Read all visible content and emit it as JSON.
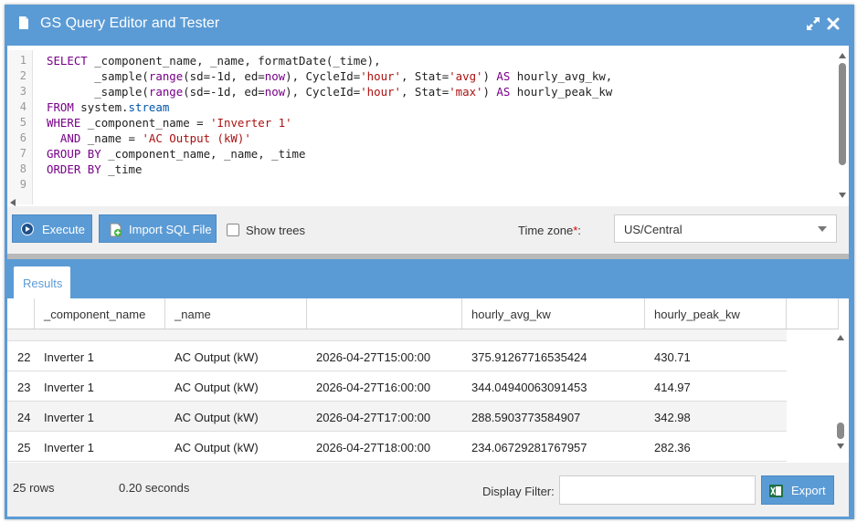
{
  "window": {
    "title": "GS Query Editor and Tester",
    "icons": [
      "document-icon",
      "expand-icon",
      "close-icon"
    ]
  },
  "editor": {
    "line_numbers": [
      "1",
      "2",
      "3",
      "4",
      "5",
      "6",
      "7",
      "8",
      "9"
    ],
    "lines": [
      [
        {
          "t": "SELECT",
          "c": "kw"
        },
        {
          "t": " _component_name, _name, formatDate(_time),",
          "c": ""
        }
      ],
      [
        {
          "t": "       _sample(",
          "c": ""
        },
        {
          "t": "range",
          "c": "kw"
        },
        {
          "t": "(sd=-1d, ed=",
          "c": ""
        },
        {
          "t": "now",
          "c": "kw"
        },
        {
          "t": "), CycleId=",
          "c": ""
        },
        {
          "t": "'hour'",
          "c": "str"
        },
        {
          "t": ", Stat=",
          "c": ""
        },
        {
          "t": "'avg'",
          "c": "str"
        },
        {
          "t": ") ",
          "c": ""
        },
        {
          "t": "AS",
          "c": "kw"
        },
        {
          "t": " hourly_avg_kw,",
          "c": ""
        }
      ],
      [
        {
          "t": "       _sample(",
          "c": ""
        },
        {
          "t": "range",
          "c": "kw"
        },
        {
          "t": "(sd=-1d, ed=",
          "c": ""
        },
        {
          "t": "now",
          "c": "kw"
        },
        {
          "t": "), CycleId=",
          "c": ""
        },
        {
          "t": "'hour'",
          "c": "str"
        },
        {
          "t": ", Stat=",
          "c": ""
        },
        {
          "t": "'max'",
          "c": "str"
        },
        {
          "t": ") ",
          "c": ""
        },
        {
          "t": "AS",
          "c": "kw"
        },
        {
          "t": " hourly_peak_kw",
          "c": ""
        }
      ],
      [
        {
          "t": "FROM",
          "c": "kw"
        },
        {
          "t": " system.",
          "c": ""
        },
        {
          "t": "stream",
          "c": "fn"
        }
      ],
      [
        {
          "t": "WHERE",
          "c": "kw"
        },
        {
          "t": " _component_name = ",
          "c": ""
        },
        {
          "t": "'Inverter 1'",
          "c": "str"
        }
      ],
      [
        {
          "t": "  AND",
          "c": "kw"
        },
        {
          "t": " _name = ",
          "c": ""
        },
        {
          "t": "'AC Output (kW)'",
          "c": "str"
        }
      ],
      [
        {
          "t": "GROUP BY",
          "c": "kw"
        },
        {
          "t": " _component_name, _name, _time",
          "c": ""
        }
      ],
      [
        {
          "t": "ORDER BY",
          "c": "kw"
        },
        {
          "t": " _time",
          "c": ""
        }
      ],
      [
        {
          "t": "",
          "c": ""
        }
      ]
    ]
  },
  "toolbar": {
    "execute_label": "Execute",
    "import_label": "Import SQL File",
    "show_trees_label": "Show trees",
    "show_trees_checked": false,
    "timezone_label": "Time zone",
    "timezone_required": "*",
    "timezone_colon": ":",
    "timezone_value": "US/Central"
  },
  "results": {
    "tab_label": "Results",
    "columns": [
      "",
      "_component_name",
      "_name",
      "",
      "hourly_avg_kw",
      "hourly_peak_kw",
      ""
    ],
    "rows": [
      [
        "22",
        "Inverter 1",
        "AC Output (kW)",
        "2026-04-27T15:00:00",
        "375.91267716535424",
        "430.71"
      ],
      [
        "23",
        "Inverter 1",
        "AC Output (kW)",
        "2026-04-27T16:00:00",
        "344.04940063091453",
        "414.97"
      ],
      [
        "24",
        "Inverter 1",
        "AC Output (kW)",
        "2026-04-27T17:00:00",
        "288.5903773584907",
        "342.98"
      ],
      [
        "25",
        "Inverter 1",
        "AC Output (kW)",
        "2026-04-27T18:00:00",
        "234.06729281767957",
        "282.36"
      ]
    ],
    "row_count": "25 rows",
    "elapsed": "0.20 seconds",
    "display_filter_label": "Display Filter:",
    "display_filter_value": "",
    "export_label": "Export"
  },
  "colors": {
    "accent": "#5b9bd5",
    "keyword": "#770088",
    "string": "#aa1111",
    "builtin": "#0055aa"
  }
}
